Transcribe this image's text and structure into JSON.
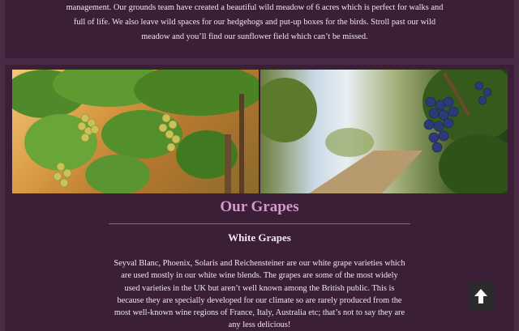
{
  "farm": {
    "description": "management. Our grounds team have created a beautiful wild meadow of 6 acres which is perfect for walks and full of life. We also leave wild spaces for our hedgehogs and put-up boxes for the birds. Stroll past our wild meadow and you’ll find our sunflower field which can’t be missed."
  },
  "grapes": {
    "title": "Our Grapes",
    "subtitle": "White Grapes",
    "body": "Seyval Blanc, Phoenix, Solaris and Reichensteiner are our white grape varieties which are used mostly in our white wine blends. The grapes are some of the most widely used varieties in the UK but aren’t well known among the British public. This is because they are specially developed for our climate so are rarely produced from the most well-known wine regions of France, Italy, Australia etc; that’s not to say they are any less delicious!"
  },
  "icons": {
    "scroll_top": "arrow-up-icon"
  },
  "colors": {
    "background": "#4a2a44",
    "panel": "#3a1f36",
    "title_accent": "#d49ac8",
    "scroll_button": "#2c2a2c"
  }
}
